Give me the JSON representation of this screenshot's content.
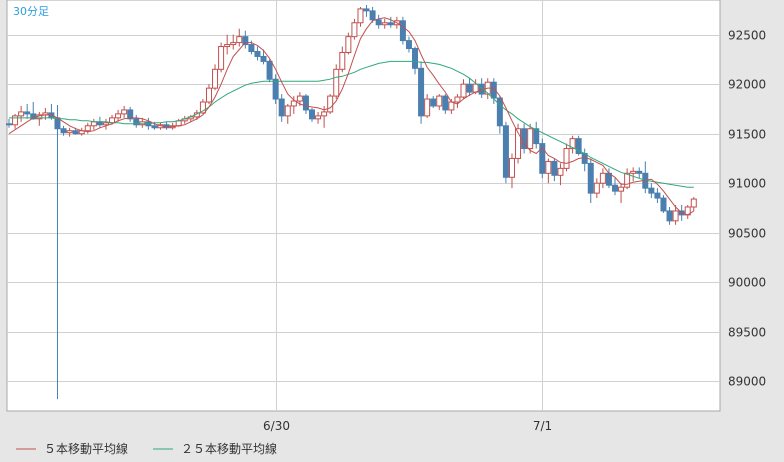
{
  "chart_data": {
    "type": "candlestick",
    "timeframe_label": "30分足",
    "x_tick_labels": [
      "6/30",
      "7/1"
    ],
    "y_ticks": [
      89000,
      89500,
      90000,
      90500,
      91000,
      91500,
      92000,
      92500
    ],
    "ylim": [
      88700,
      92850
    ],
    "grid": true,
    "legend_position": "bottom-left",
    "colors": {
      "up_body": "#ffffff",
      "up_border": "#c0504d",
      "down": "#4a7fb0",
      "ma5": "#c0504d",
      "ma25": "#2ea87a",
      "timeframe_text": "#2f9de0",
      "plot_bg": "#ffffff",
      "frame_bg": "#e6e6e6",
      "grid": "#d0d0d0"
    },
    "legend": [
      {
        "label": "５本移動平均線",
        "color": "#c0504d"
      },
      {
        "label": "２５本移動平均線",
        "color": "#2ea87a"
      }
    ],
    "candles": [
      [
        91600,
        91650,
        91560,
        91590
      ],
      [
        91590,
        91700,
        91550,
        91680
      ],
      [
        91680,
        91780,
        91620,
        91720
      ],
      [
        91720,
        91800,
        91650,
        91700
      ],
      [
        91700,
        91820,
        91640,
        91650
      ],
      [
        91650,
        91720,
        91580,
        91690
      ],
      [
        91690,
        91760,
        91640,
        91710
      ],
      [
        91710,
        91800,
        91640,
        91660
      ],
      [
        91660,
        91790,
        88820,
        91550
      ],
      [
        91550,
        91580,
        91480,
        91510
      ],
      [
        91510,
        91560,
        91470,
        91530
      ],
      [
        91530,
        91560,
        91490,
        91500
      ],
      [
        91500,
        91560,
        91480,
        91530
      ],
      [
        91530,
        91610,
        91500,
        91580
      ],
      [
        91580,
        91650,
        91540,
        91620
      ],
      [
        91620,
        91670,
        91560,
        91590
      ],
      [
        91590,
        91650,
        91540,
        91610
      ],
      [
        91610,
        91690,
        91590,
        91660
      ],
      [
        91660,
        91740,
        91620,
        91700
      ],
      [
        91700,
        91780,
        91660,
        91740
      ],
      [
        91740,
        91770,
        91620,
        91650
      ],
      [
        91650,
        91690,
        91560,
        91590
      ],
      [
        91590,
        91660,
        91560,
        91620
      ],
      [
        91620,
        91660,
        91540,
        91580
      ],
      [
        91580,
        91620,
        91540,
        91560
      ],
      [
        91560,
        91610,
        91540,
        91590
      ],
      [
        91590,
        91620,
        91540,
        91560
      ],
      [
        91560,
        91610,
        91540,
        91580
      ],
      [
        91580,
        91650,
        91570,
        91630
      ],
      [
        91630,
        91680,
        91600,
        91650
      ],
      [
        91650,
        91690,
        91620,
        91670
      ],
      [
        91670,
        91740,
        91640,
        91710
      ],
      [
        91710,
        91850,
        91700,
        91820
      ],
      [
        91820,
        92000,
        91800,
        91960
      ],
      [
        91960,
        92200,
        91940,
        92150
      ],
      [
        92150,
        92420,
        92120,
        92380
      ],
      [
        92380,
        92500,
        92300,
        92400
      ],
      [
        92400,
        92500,
        92350,
        92420
      ],
      [
        92420,
        92560,
        92380,
        92480
      ],
      [
        92480,
        92540,
        92360,
        92400
      ],
      [
        92400,
        92440,
        92300,
        92330
      ],
      [
        92330,
        92380,
        92240,
        92280
      ],
      [
        92280,
        92350,
        92200,
        92230
      ],
      [
        92230,
        92250,
        92020,
        92050
      ],
      [
        92050,
        92100,
        91800,
        91850
      ],
      [
        91850,
        91900,
        91620,
        91680
      ],
      [
        91680,
        91800,
        91600,
        91780
      ],
      [
        91780,
        91880,
        91700,
        91830
      ],
      [
        91830,
        91920,
        91780,
        91880
      ],
      [
        91880,
        91900,
        91700,
        91740
      ],
      [
        91740,
        91760,
        91620,
        91650
      ],
      [
        91650,
        91720,
        91600,
        91680
      ],
      [
        91680,
        91780,
        91560,
        91720
      ],
      [
        91720,
        91900,
        91700,
        91880
      ],
      [
        91880,
        92200,
        91850,
        92150
      ],
      [
        92150,
        92380,
        92120,
        92320
      ],
      [
        92320,
        92520,
        92300,
        92480
      ],
      [
        92480,
        92660,
        92450,
        92620
      ],
      [
        92620,
        92780,
        92580,
        92760
      ],
      [
        92760,
        92800,
        92680,
        92740
      ],
      [
        92740,
        92780,
        92620,
        92650
      ],
      [
        92650,
        92700,
        92560,
        92600
      ],
      [
        92600,
        92660,
        92560,
        92620
      ],
      [
        92620,
        92680,
        92570,
        92600
      ],
      [
        92600,
        92680,
        92560,
        92640
      ],
      [
        92640,
        92680,
        92400,
        92440
      ],
      [
        92440,
        92480,
        92320,
        92360
      ],
      [
        92360,
        92380,
        92100,
        92160
      ],
      [
        92160,
        92230,
        91600,
        91680
      ],
      [
        91680,
        91900,
        91660,
        91850
      ],
      [
        91850,
        91880,
        91760,
        91780
      ],
      [
        91780,
        91900,
        91740,
        91880
      ],
      [
        91880,
        91900,
        91700,
        91740
      ],
      [
        91740,
        91850,
        91700,
        91820
      ],
      [
        91820,
        91900,
        91760,
        91870
      ],
      [
        91870,
        92050,
        91850,
        92000
      ],
      [
        92000,
        92060,
        91880,
        91920
      ],
      [
        91920,
        92050,
        91900,
        92000
      ],
      [
        92000,
        92060,
        91860,
        91900
      ],
      [
        91900,
        92060,
        91850,
        92020
      ],
      [
        92020,
        92060,
        91800,
        91860
      ],
      [
        91860,
        91880,
        91500,
        91580
      ],
      [
        91580,
        91620,
        91000,
        91060
      ],
      [
        91060,
        91300,
        90950,
        91250
      ],
      [
        91250,
        91600,
        91200,
        91550
      ],
      [
        91550,
        91600,
        91300,
        91350
      ],
      [
        91350,
        91600,
        91300,
        91550
      ],
      [
        91550,
        91620,
        91350,
        91400
      ],
      [
        91400,
        91450,
        91050,
        91100
      ],
      [
        91100,
        91250,
        91000,
        91220
      ],
      [
        91220,
        91250,
        91020,
        91080
      ],
      [
        91080,
        91200,
        90980,
        91150
      ],
      [
        91150,
        91400,
        91120,
        91350
      ],
      [
        91350,
        91480,
        91300,
        91450
      ],
      [
        91450,
        91480,
        91280,
        91300
      ],
      [
        91300,
        91350,
        91120,
        91200
      ],
      [
        91200,
        91250,
        90800,
        90900
      ],
      [
        90900,
        91050,
        90850,
        91000
      ],
      [
        91000,
        91150,
        90950,
        91100
      ],
      [
        91100,
        91150,
        90950,
        90980
      ],
      [
        90980,
        91050,
        90880,
        90920
      ],
      [
        90920,
        91000,
        90800,
        90960
      ],
      [
        90960,
        91150,
        90940,
        91100
      ],
      [
        91100,
        91160,
        91020,
        91120
      ],
      [
        91120,
        91160,
        91050,
        91100
      ],
      [
        91100,
        91220,
        90900,
        90950
      ],
      [
        90950,
        91000,
        90850,
        90900
      ],
      [
        90900,
        90950,
        90800,
        90850
      ],
      [
        90850,
        90880,
        90700,
        90720
      ],
      [
        90720,
        90760,
        90580,
        90620
      ],
      [
        90620,
        90780,
        90580,
        90720
      ],
      [
        90720,
        90780,
        90620,
        90680
      ],
      [
        90680,
        90780,
        90640,
        90760
      ],
      [
        90760,
        90860,
        90720,
        90840
      ]
    ],
    "ma5": [
      91500,
      91540,
      91580,
      91620,
      91660,
      91680,
      91690,
      91690,
      91660,
      91620,
      91580,
      91550,
      91530,
      91520,
      91530,
      91560,
      91580,
      91600,
      91630,
      91650,
      91660,
      91660,
      91650,
      91630,
      91600,
      91580,
      91570,
      91570,
      91580,
      91590,
      91620,
      91650,
      91690,
      91770,
      91870,
      92000,
      92150,
      92280,
      92350,
      92420,
      92420,
      92390,
      92340,
      92260,
      92150,
      92020,
      91900,
      91840,
      91800,
      91780,
      91770,
      91760,
      91740,
      91760,
      91830,
      91950,
      92110,
      92290,
      92460,
      92560,
      92640,
      92660,
      92670,
      92650,
      92620,
      92580,
      92530,
      92440,
      92300,
      92170,
      92090,
      92000,
      91920,
      91820,
      91800,
      91850,
      91890,
      91920,
      91940,
      91960,
      91960,
      91880,
      91760,
      91630,
      91510,
      91400,
      91330,
      91300,
      91360,
      91280,
      91250,
      91210,
      91200,
      91220,
      91250,
      91260,
      91240,
      91210,
      91180,
      91100,
      91060,
      90990,
      90990,
      91010,
      91020,
      91030,
      91040,
      90990,
      90920,
      90840,
      90760,
      90700,
      90680,
      90720
    ],
    "ma25": [
      91660,
      91660,
      91660,
      91660,
      91660,
      91660,
      91660,
      91660,
      91650,
      91650,
      91640,
      91640,
      91630,
      91630,
      91620,
      91620,
      91620,
      91610,
      91610,
      91600,
      91600,
      91600,
      91600,
      91600,
      91610,
      91610,
      91620,
      91620,
      91630,
      91650,
      91670,
      91700,
      91730,
      91770,
      91820,
      91860,
      91900,
      91930,
      91960,
      91990,
      92010,
      92020,
      92030,
      92030,
      92030,
      92030,
      92030,
      92030,
      92030,
      92030,
      92030,
      92030,
      92040,
      92050,
      92070,
      92080,
      92100,
      92120,
      92150,
      92170,
      92190,
      92210,
      92220,
      92230,
      92230,
      92230,
      92230,
      92230,
      92220,
      92220,
      92210,
      92200,
      92180,
      92160,
      92130,
      92100,
      92060,
      92010,
      91960,
      91910,
      91850,
      91790,
      91740,
      91700,
      91650,
      91610,
      91570,
      91540,
      91510,
      91480,
      91450,
      91420,
      91390,
      91360,
      91330,
      91300,
      91260,
      91230,
      91200,
      91170,
      91140,
      91110,
      91090,
      91070,
      91050,
      91030,
      91020,
      91010,
      91000,
      90990,
      90980,
      90970,
      90960,
      90960
    ]
  }
}
